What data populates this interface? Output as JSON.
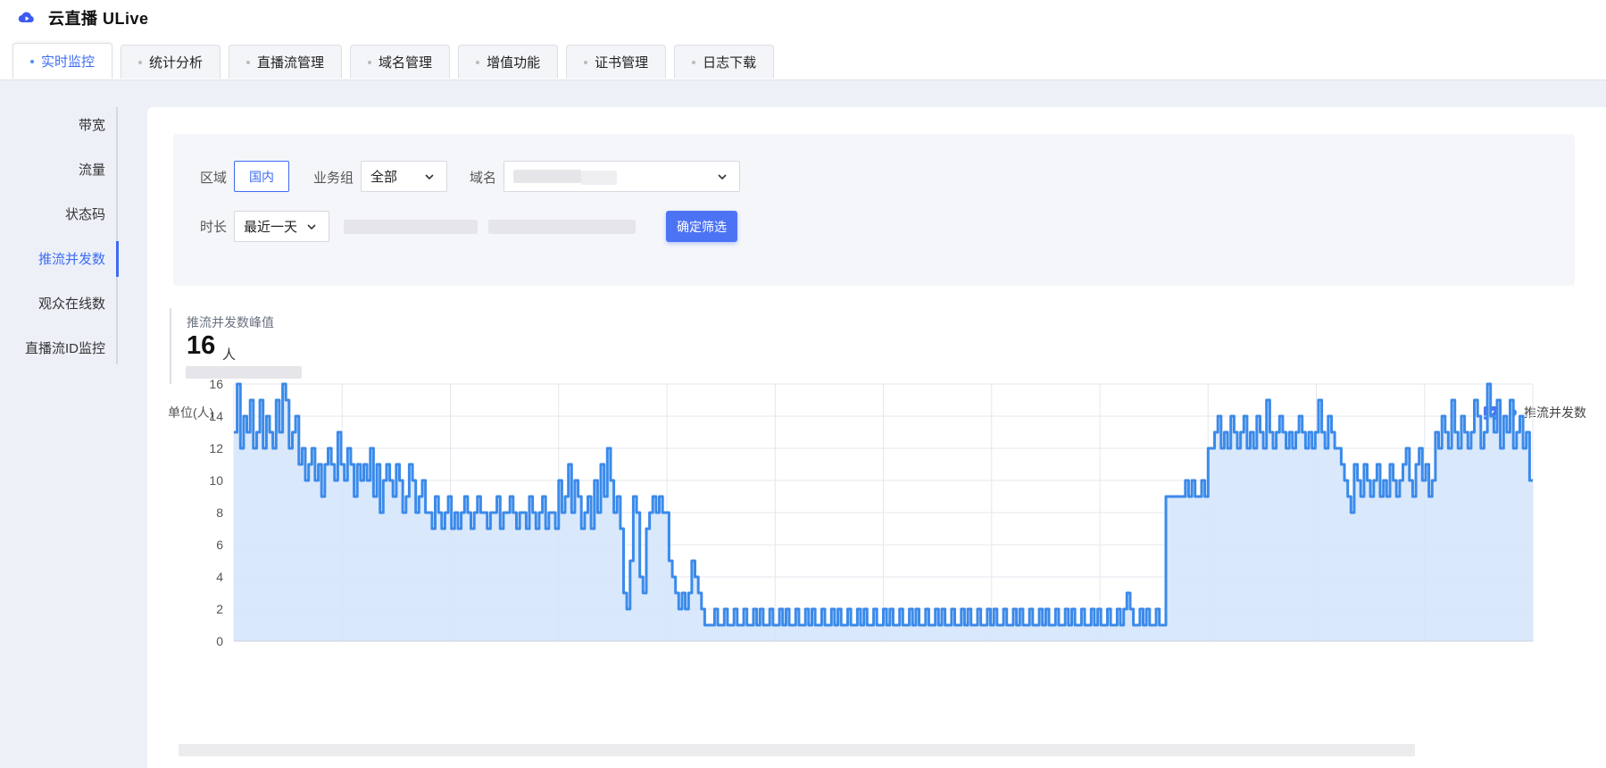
{
  "app": {
    "title": "云直播 ULive"
  },
  "tabs": [
    {
      "label": "实时监控",
      "active": true
    },
    {
      "label": "统计分析",
      "active": false
    },
    {
      "label": "直播流管理",
      "active": false
    },
    {
      "label": "域名管理",
      "active": false
    },
    {
      "label": "增值功能",
      "active": false
    },
    {
      "label": "证书管理",
      "active": false
    },
    {
      "label": "日志下载",
      "active": false
    }
  ],
  "sidebar": {
    "items": [
      {
        "label": "带宽"
      },
      {
        "label": "流量"
      },
      {
        "label": "状态码"
      },
      {
        "label": "推流并发数",
        "active": true
      },
      {
        "label": "观众在线数"
      },
      {
        "label": "直播流ID监控"
      }
    ]
  },
  "filters": {
    "region_label": "区域",
    "region_value": "国内",
    "group_label": "业务组",
    "group_value": "全部",
    "domain_label": "域名",
    "duration_label": "时长",
    "duration_value": "最近一天",
    "confirm_label": "确定筛选"
  },
  "summary": {
    "title": "推流并发数峰值",
    "value": "16",
    "unit": "人"
  },
  "colors": {
    "accent": "#3d6cf5",
    "series": "#3b8aea",
    "area": "#d5e6fb"
  },
  "chart_data": {
    "type": "area",
    "unit_label": "单位(人)",
    "legend": [
      "推流并发数"
    ],
    "ylim": [
      0,
      16
    ],
    "yticks": [
      0,
      2,
      4,
      6,
      8,
      10,
      12,
      14,
      16
    ],
    "grid": true,
    "legend_position": "top-right",
    "series": [
      {
        "name": "推流并发数",
        "values": [
          13,
          16,
          12,
          14,
          13,
          15,
          12,
          13,
          15,
          12,
          14,
          13,
          12,
          15,
          13,
          16,
          15,
          12,
          13,
          14,
          11,
          12,
          10,
          11,
          12,
          10,
          11,
          9,
          11,
          12,
          11,
          10,
          13,
          11,
          10,
          12,
          11,
          9,
          11,
          10,
          11,
          10,
          12,
          9,
          11,
          8,
          10,
          11,
          10,
          9,
          11,
          10,
          8,
          9,
          11,
          10,
          8,
          9,
          10,
          8,
          8,
          7,
          9,
          8,
          7,
          8,
          9,
          7,
          8,
          7,
          8,
          9,
          8,
          7,
          8,
          9,
          8,
          8,
          7,
          8,
          8,
          9,
          7,
          8,
          8,
          9,
          8,
          7,
          8,
          8,
          7,
          9,
          8,
          7,
          8,
          9,
          7,
          8,
          8,
          7,
          10,
          8,
          9,
          11,
          8,
          10,
          9,
          7,
          8,
          9,
          7,
          10,
          8,
          11,
          9,
          12,
          10,
          8,
          9,
          7,
          3,
          2,
          5,
          9,
          8,
          4,
          3,
          7,
          8,
          9,
          8,
          9,
          8,
          8,
          5,
          4,
          3,
          2,
          3,
          2,
          3,
          5,
          4,
          3,
          2,
          1,
          1,
          1,
          2,
          1,
          1,
          2,
          1,
          1,
          2,
          1,
          1,
          2,
          1,
          1,
          2,
          1,
          2,
          1,
          1,
          2,
          1,
          1,
          2,
          1,
          2,
          1,
          1,
          2,
          1,
          1,
          2,
          1,
          2,
          1,
          1,
          2,
          1,
          1,
          2,
          1,
          2,
          1,
          1,
          2,
          1,
          1,
          2,
          1,
          2,
          1,
          1,
          2,
          1,
          1,
          2,
          1,
          2,
          1,
          1,
          2,
          1,
          1,
          2,
          1,
          2,
          1,
          1,
          2,
          1,
          1,
          2,
          1,
          2,
          1,
          1,
          2,
          1,
          1,
          2,
          1,
          2,
          1,
          1,
          2,
          1,
          1,
          2,
          1,
          2,
          1,
          1,
          2,
          1,
          1,
          2,
          1,
          2,
          1,
          1,
          2,
          1,
          1,
          2,
          1,
          2,
          1,
          1,
          2,
          1,
          1,
          2,
          1,
          2,
          1,
          1,
          2,
          1,
          1,
          2,
          1,
          2,
          1,
          1,
          2,
          1,
          1,
          2,
          1,
          2,
          3,
          2,
          1,
          1,
          2,
          1,
          2,
          1,
          1,
          2,
          1,
          1,
          9,
          9,
          9,
          9,
          9,
          9,
          10,
          9,
          10,
          9,
          9,
          10,
          9,
          12,
          12,
          13,
          14,
          12,
          13,
          12,
          14,
          13,
          12,
          13,
          14,
          12,
          13,
          12,
          14,
          13,
          12,
          15,
          13,
          12,
          13,
          14,
          13,
          12,
          13,
          12,
          13,
          14,
          13,
          12,
          13,
          12,
          13,
          15,
          13,
          12,
          14,
          13,
          12,
          12,
          11,
          10,
          9,
          8,
          11,
          10,
          9,
          11,
          10,
          9,
          10,
          11,
          9,
          10,
          9,
          11,
          10,
          9,
          10,
          11,
          12,
          10,
          9,
          11,
          12,
          10,
          11,
          9,
          10,
          13,
          12,
          14,
          13,
          12,
          15,
          13,
          12,
          14,
          13,
          12,
          13,
          15,
          14,
          12,
          13,
          16,
          14,
          13,
          15,
          12,
          14,
          13,
          15,
          12,
          13,
          14,
          12,
          13,
          10
        ]
      }
    ]
  }
}
